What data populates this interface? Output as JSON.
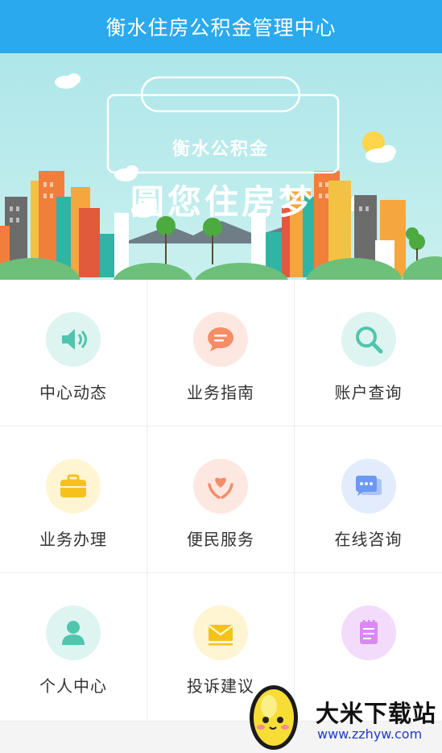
{
  "header": {
    "title": "衡水住房公积金管理中心"
  },
  "banner": {
    "tagline_small": "衡水公积金",
    "tagline_big": "圆您住房梦"
  },
  "menu": [
    {
      "label": "中心动态",
      "icon": "speaker-icon",
      "bg": "#def4f0",
      "color": "#4fc5ae"
    },
    {
      "label": "业务指南",
      "icon": "chat-bubble-icon",
      "bg": "#fde8e1",
      "color": "#f58d67"
    },
    {
      "label": "账户查询",
      "icon": "search-icon",
      "bg": "#def4f0",
      "color": "#4fc5ae"
    },
    {
      "label": "业务办理",
      "icon": "briefcase-icon",
      "bg": "#fff5d3",
      "color": "#f5c21b"
    },
    {
      "label": "便民服务",
      "icon": "hands-heart-icon",
      "bg": "#fde8e1",
      "color": "#f58d67"
    },
    {
      "label": "在线咨询",
      "icon": "message-dots-icon",
      "bg": "#e2ecfc",
      "color": "#6c98f0"
    },
    {
      "label": "个人中心",
      "icon": "person-icon",
      "bg": "#def4f0",
      "color": "#4fc5ae"
    },
    {
      "label": "投诉建议",
      "icon": "envelope-icon",
      "bg": "#fff5d3",
      "color": "#f5c21b"
    },
    {
      "label": "",
      "icon": "notepad-icon",
      "bg": "#f3dcfb",
      "color": "#d98af2"
    }
  ],
  "watermark": {
    "title": "大米下载站",
    "url": "www.zzhyw.com"
  }
}
